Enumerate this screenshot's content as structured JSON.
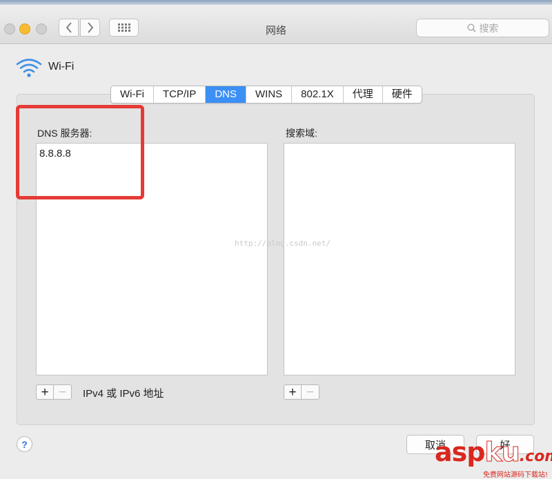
{
  "window": {
    "title": "网络"
  },
  "toolbar": {
    "search_placeholder": "搜索"
  },
  "header": {
    "interface_name": "Wi-Fi"
  },
  "tabs": [
    {
      "label": "Wi-Fi",
      "active": false
    },
    {
      "label": "TCP/IP",
      "active": false
    },
    {
      "label": "DNS",
      "active": true
    },
    {
      "label": "WINS",
      "active": false
    },
    {
      "label": "802.1X",
      "active": false
    },
    {
      "label": "代理",
      "active": false
    },
    {
      "label": "硬件",
      "active": false
    }
  ],
  "dns": {
    "label": "DNS 服务器:",
    "servers": [
      "8.8.8.8"
    ],
    "hint": "IPv4 或 IPv6 地址",
    "add_label": "+",
    "remove_label": "−"
  },
  "search_domains": {
    "label": "搜索域:",
    "add_label": "+",
    "remove_label": "−"
  },
  "footer": {
    "help_label": "?",
    "cancel_label": "取消",
    "ok_label": "好"
  },
  "overlay": {
    "watermark_text": "http://blog.csdn.net/",
    "logo_asp": "asp",
    "logo_ku": "ku",
    "logo_com": ".com",
    "logo_tagline": "免费网站源码下载站!"
  },
  "colors": {
    "accent": "#3b8ff5",
    "highlight": "#e53a35",
    "window_bg": "#ececec",
    "logo": "#d8281f"
  }
}
